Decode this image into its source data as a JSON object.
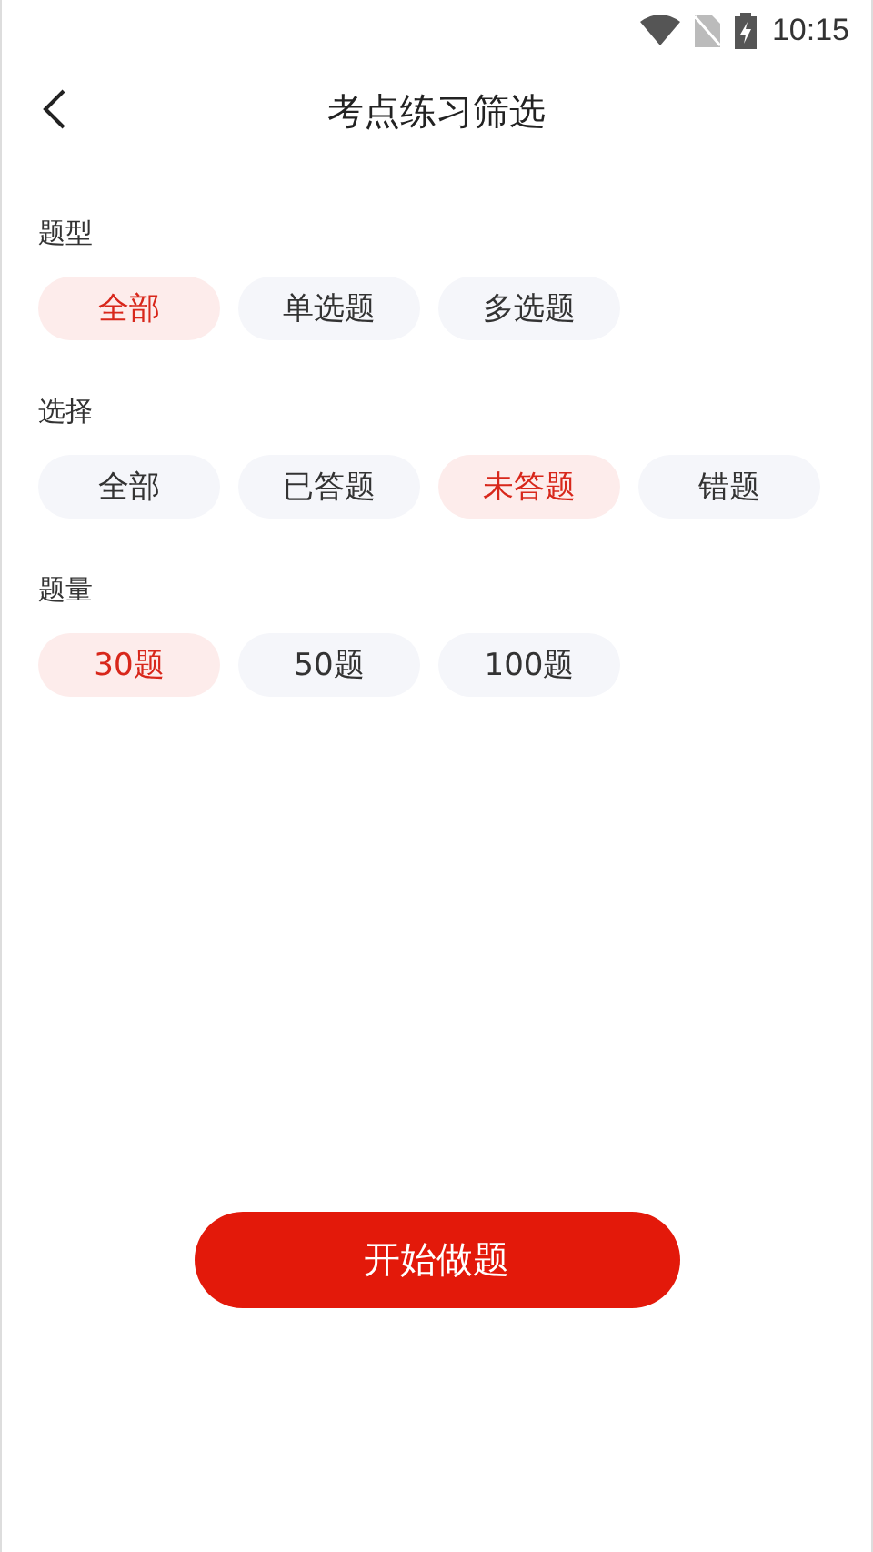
{
  "status_bar": {
    "time": "10:15"
  },
  "header": {
    "title": "考点练习筛选"
  },
  "sections": [
    {
      "label": "题型",
      "options": [
        {
          "label": "全部",
          "selected": true
        },
        {
          "label": "单选题",
          "selected": false
        },
        {
          "label": "多选题",
          "selected": false
        }
      ]
    },
    {
      "label": "选择",
      "options": [
        {
          "label": "全部",
          "selected": false
        },
        {
          "label": "已答题",
          "selected": false
        },
        {
          "label": "未答题",
          "selected": true
        },
        {
          "label": "错题",
          "selected": false
        }
      ]
    },
    {
      "label": "题量",
      "options": [
        {
          "label": "30题",
          "selected": true
        },
        {
          "label": "50题",
          "selected": false
        },
        {
          "label": "100题",
          "selected": false
        }
      ]
    }
  ],
  "start_button": {
    "label": "开始做题"
  }
}
